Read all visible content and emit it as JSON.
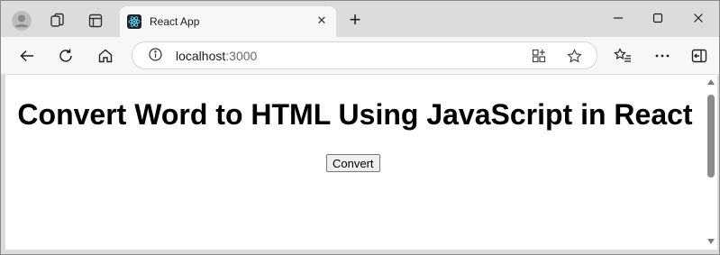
{
  "browser": {
    "tab": {
      "title": "React App",
      "favicon": "react-icon"
    },
    "address": {
      "host": "localhost",
      "port": ":3000"
    },
    "icons": {
      "profile": "avatar-icon",
      "workspaces": "workspaces-icon",
      "tab_actions": "tab-actions-icon",
      "back": "back-arrow-icon",
      "refresh": "refresh-icon",
      "home": "home-icon",
      "info": "info-icon",
      "app_available": "app-available-icon",
      "favorite": "star-icon",
      "favorites": "favorites-icon",
      "more": "more-icon",
      "sidebar": "sidebar-icon"
    }
  },
  "page": {
    "title": "Convert Word to HTML Using JavaScript in React",
    "convert_label": "Convert"
  }
}
